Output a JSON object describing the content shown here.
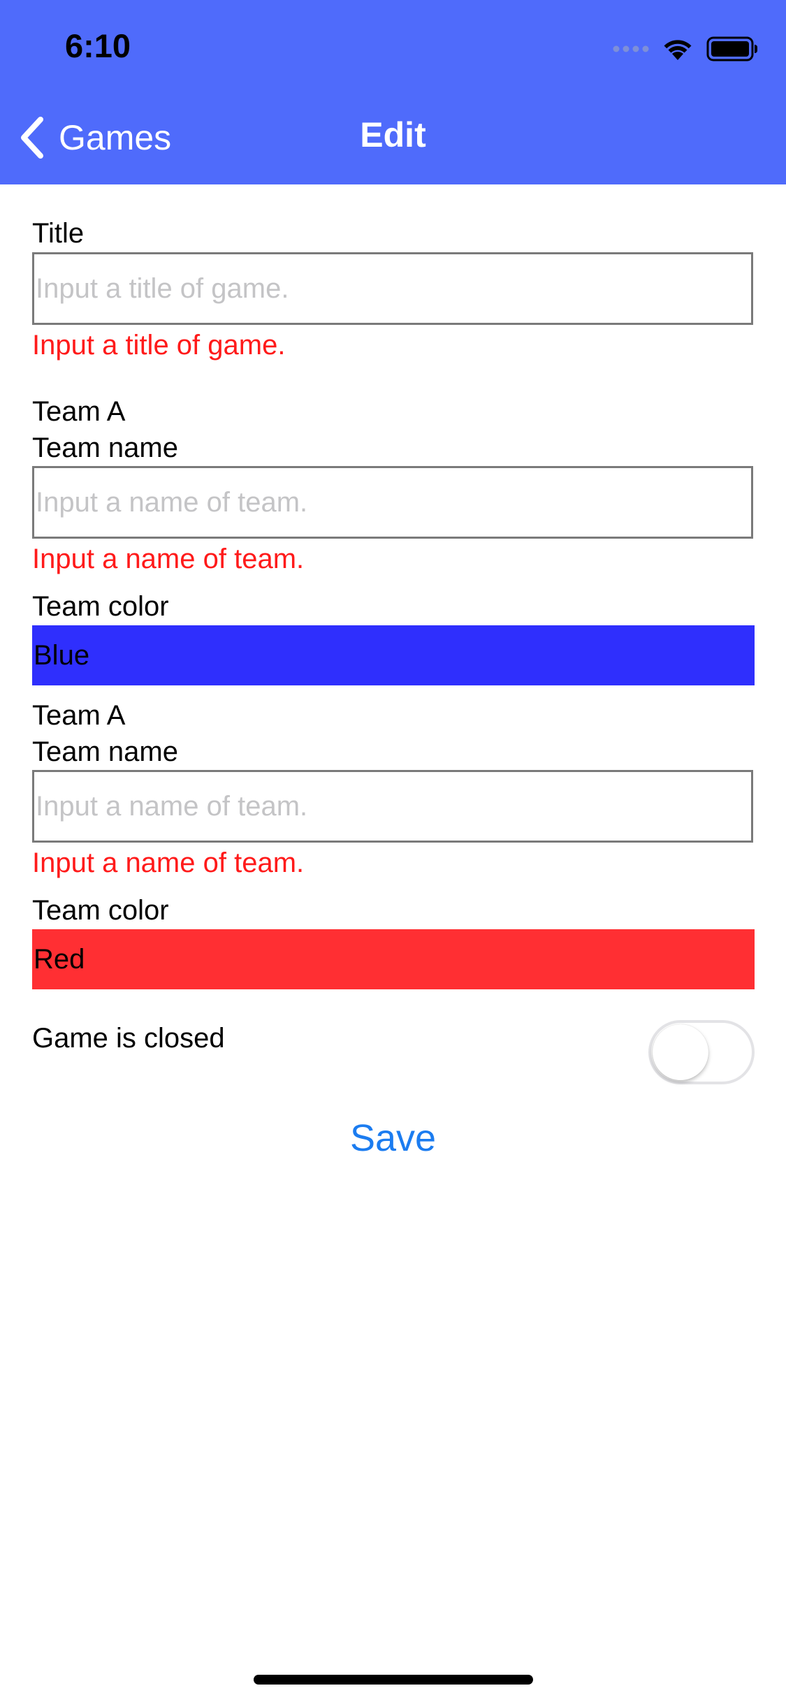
{
  "status_bar": {
    "time": "6:10"
  },
  "nav": {
    "back_label": "Games",
    "title": "Edit"
  },
  "form": {
    "title_field": {
      "label": "Title",
      "value": "",
      "placeholder": "Input a title of game.",
      "error": "Input a title of game."
    },
    "team_a": {
      "heading": "Team A",
      "name_label": "Team name",
      "name_value": "",
      "name_placeholder": "Input a name of team.",
      "name_error": "Input a name of team.",
      "color_label": "Team color",
      "color_value": "Blue",
      "color_hex": "#2f2ffd"
    },
    "team_b": {
      "heading": "Team A",
      "name_label": "Team name",
      "name_value": "",
      "name_placeholder": "Input a name of team.",
      "name_error": "Input a name of team.",
      "color_label": "Team color",
      "color_value": "Red",
      "color_hex": "#ff2f33"
    },
    "closed_toggle": {
      "label": "Game is closed",
      "on": false
    },
    "save_label": "Save"
  },
  "colors": {
    "nav_bar": "#4f6bfb",
    "error": "#ff1a1a",
    "link": "#1b7cf0"
  }
}
